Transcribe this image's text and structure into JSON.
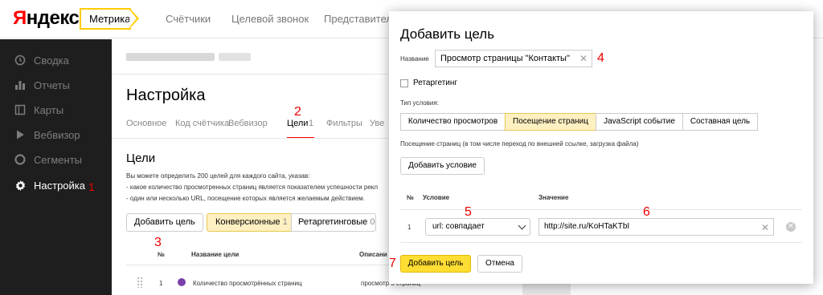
{
  "header": {
    "logo": "Яндекс",
    "product": "Метрика",
    "nav": [
      "Счётчики",
      "Целевой звонок",
      "Представитель"
    ]
  },
  "sidebar": {
    "items": [
      {
        "label": "Сводка",
        "icon": "clock-icon"
      },
      {
        "label": "Отчеты",
        "icon": "bar-chart-icon"
      },
      {
        "label": "Карты",
        "icon": "map-icon"
      },
      {
        "label": "Вебвизор",
        "icon": "play-icon"
      },
      {
        "label": "Сегменты",
        "icon": "pie-icon"
      },
      {
        "label": "Настройка",
        "icon": "gear-icon",
        "active": true
      }
    ]
  },
  "main": {
    "title": "Настройка",
    "tabs": [
      "Основное",
      "Код счётчика",
      "Вебвизор",
      "Цели",
      "1",
      "Фильтры",
      "Уве"
    ],
    "goals_title": "Цели",
    "description": [
      "Вы можете определить 200 целей для каждого сайта, указав:",
      "- какое количество просмотренных страниц является показателем успешности рекл",
      "- один или несколько URL, посещение которых является желаемым действием."
    ],
    "add_goal": "Добавить цель",
    "filter": {
      "conversion": "Конверсионные",
      "conversion_count": "1",
      "retarget": "Ретаргетинговые",
      "retarget_count": "0"
    },
    "table_headers": [
      "№",
      "Название цели",
      "Описани"
    ],
    "row": {
      "num": "1",
      "name": "Количество просмотрённых страниц",
      "desc": "просмотр 3 страниц"
    }
  },
  "annotations": [
    "1",
    "2",
    "3",
    "4",
    "5",
    "6",
    "7"
  ],
  "modal": {
    "title": "Добавить цель",
    "name_label": "Название",
    "name_value": "Просмотр страницы \"Контакты\"",
    "retarget_label": "Ретаргетинг",
    "cond_type_label": "Тип условия:",
    "cond_tabs": [
      "Количество просмотров",
      "Посещение страниц",
      "JavaScript событие",
      "Составная цель"
    ],
    "cond_hint": "Посещение страниц (в том числе переход по внешней ссылке, загрузка файла)",
    "add_condition": "Добавить условие",
    "col_num": "№",
    "col_cond": "Условие",
    "col_value": "Значение",
    "row_num": "1",
    "select_value": "url: совпадает",
    "value_input": "http://site.ru/KoHTaKTbI",
    "submit": "Добавить цель",
    "cancel": "Отмена"
  }
}
